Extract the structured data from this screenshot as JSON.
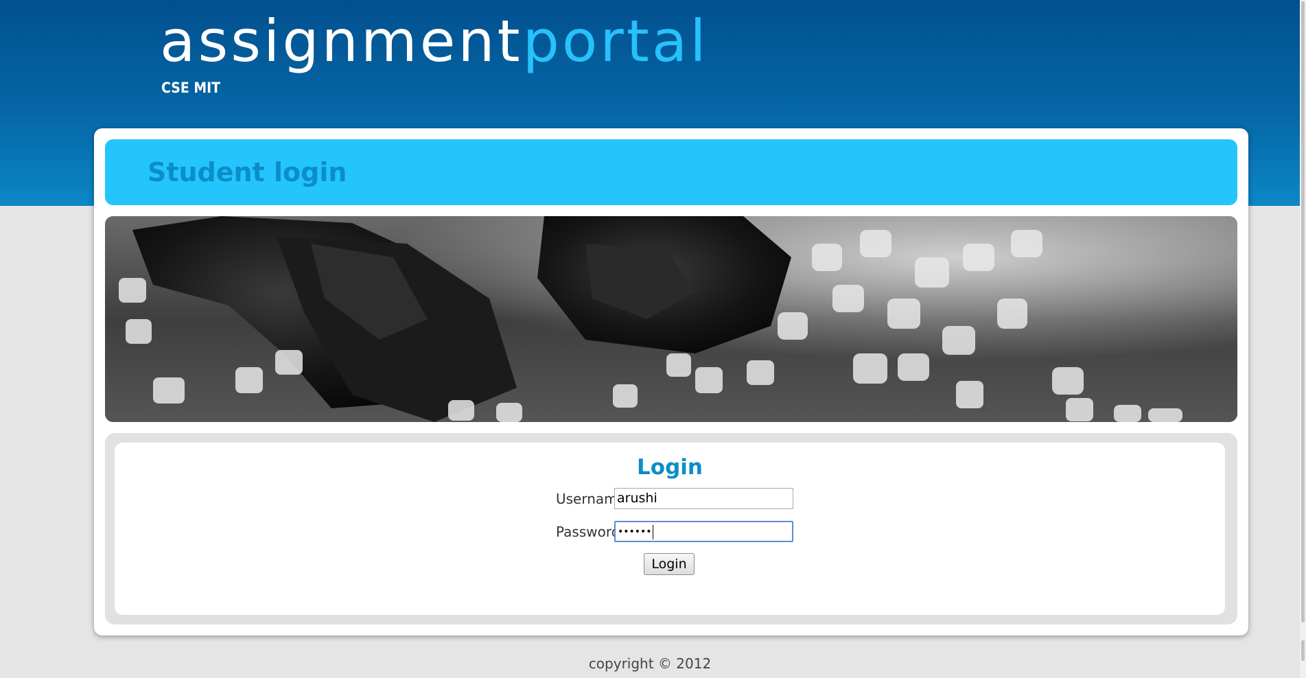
{
  "header": {
    "title_part1": "assignment",
    "title_part2": "portal",
    "subtitle": "CSE MIT"
  },
  "page": {
    "heading": "Student login"
  },
  "banner": {
    "description_icon": "sugar-crystals-photo"
  },
  "login": {
    "title": "Login",
    "username_label": "Username",
    "username_value": "arushi",
    "password_label": "Password",
    "password_value": "••••••",
    "submit_label": "Login"
  },
  "footer": {
    "copyright": "copyright © 2012"
  },
  "colors": {
    "header_dark": "#02508e",
    "accent_cyan": "#24c4fd",
    "heading_blue": "#0b8ec7",
    "title_light": "#27c1fb"
  }
}
